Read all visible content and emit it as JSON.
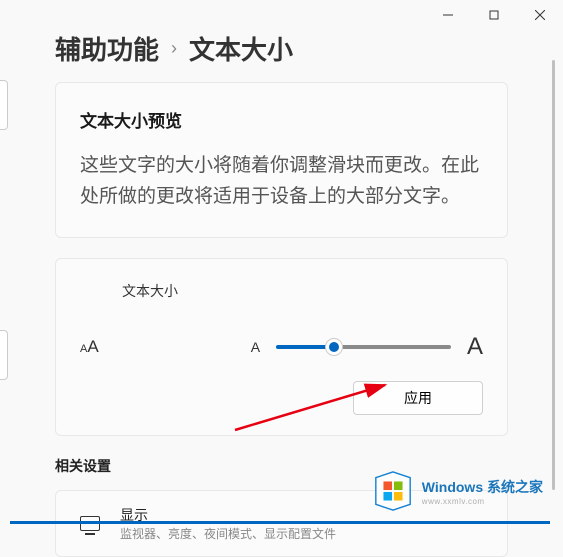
{
  "titlebar": {
    "minimize": "minimize",
    "maximize": "maximize",
    "close": "close"
  },
  "breadcrumb": {
    "parent": "辅助功能",
    "separator": "›",
    "current": "文本大小"
  },
  "preview": {
    "title": "文本大小预览",
    "text": "这些文字的大小将随着你调整滑块而更改。在此处所做的更改将适用于设备上的大部分文字。"
  },
  "slider": {
    "label": "文本大小",
    "icon_small": "A",
    "icon_large": "A",
    "min_label": "A",
    "max_label": "A",
    "apply_label": "应用"
  },
  "related": {
    "section_title": "相关设置",
    "item": {
      "title": "显示",
      "subtitle": "监视器、亮度、夜间模式、显示配置文件"
    }
  },
  "watermark": {
    "brand": "Windows 系统之家",
    "url": "www.xxmlv.com"
  }
}
